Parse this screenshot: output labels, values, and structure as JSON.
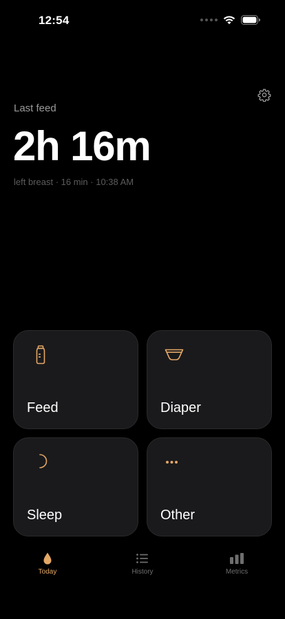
{
  "status_bar": {
    "time": "12:54"
  },
  "header": {
    "last_feed_label": "Last feed",
    "elapsed": "2h 16m",
    "details": "left breast · 16 min · 10:38 AM",
    "settings_icon": "gear-icon"
  },
  "tiles": [
    {
      "label": "Feed",
      "icon": "bottle-icon"
    },
    {
      "label": "Diaper",
      "icon": "diaper-icon"
    },
    {
      "label": "Sleep",
      "icon": "moon-icon"
    },
    {
      "label": "Other",
      "icon": "more-dots-icon"
    }
  ],
  "tab_bar": {
    "tabs": [
      {
        "label": "Today",
        "icon": "drop-icon",
        "active": true
      },
      {
        "label": "History",
        "icon": "list-icon",
        "active": false
      },
      {
        "label": "Metrics",
        "icon": "bar-chart-icon",
        "active": false
      }
    ]
  },
  "colors": {
    "accent": "#e4a866",
    "background": "#000000",
    "tile_background": "#1a1a1c",
    "inactive_tab": "#6e6e6e",
    "secondary_text": "#9a9a9a",
    "tertiary_text": "#5c5c5c"
  }
}
